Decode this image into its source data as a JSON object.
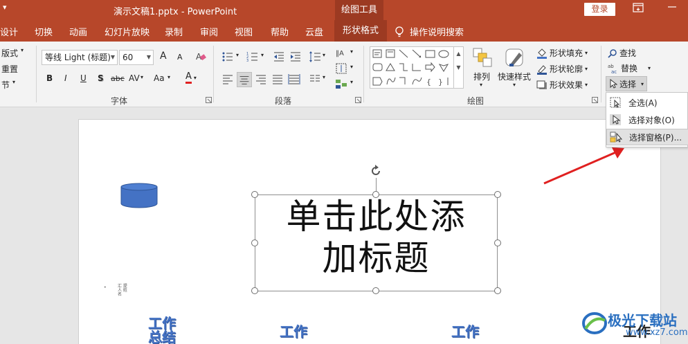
{
  "titlebar": {
    "quick_access": "▾",
    "doc_title": "演示文稿1.pptx  -  PowerPoint",
    "contextual_group": "绘图工具",
    "login": "登录"
  },
  "tabs": [
    {
      "label": "设计"
    },
    {
      "label": "切换"
    },
    {
      "label": "动画"
    },
    {
      "label": "幻灯片放映"
    },
    {
      "label": "录制"
    },
    {
      "label": "审阅"
    },
    {
      "label": "视图"
    },
    {
      "label": "帮助"
    },
    {
      "label": "云盘"
    },
    {
      "label": "形状格式"
    }
  ],
  "tell_me": "操作说明搜索",
  "ribbon": {
    "slides_group": {
      "layout": "版式",
      "reset": "重置",
      "section": "节"
    },
    "font_group": {
      "label": "字体",
      "font_name": "等线 Light (标题)",
      "font_size": "60",
      "bold": "B",
      "italic": "I",
      "underline": "U",
      "shadow": "S",
      "strike": "abc",
      "spacing": "AV",
      "case": "Aa",
      "color": "A",
      "grow": "A",
      "shrink": "A"
    },
    "paragraph_group": {
      "label": "段落"
    },
    "drawing_group": {
      "label": "绘图",
      "arrange": "排列",
      "quick_styles": "快速样式",
      "shape_fill": "形状填充",
      "shape_outline": "形状轮廓",
      "shape_effects": "形状效果"
    },
    "editing_group": {
      "find": "查找",
      "replace": "替换",
      "select": "选择"
    }
  },
  "select_menu": {
    "items": [
      {
        "label": "全选(A)"
      },
      {
        "label": "选择对象(O)"
      },
      {
        "label": "选择窗格(P)..."
      }
    ]
  },
  "slide": {
    "title_placeholder_line1": "单击此处添",
    "title_placeholder_line2": "加标题",
    "wordart_1": "工作\n总结",
    "wordart_2": "工作",
    "wordart_3": "工作",
    "wordart_4": "工作",
    "tiny_text": "汇 提\n人 姓\n名"
  },
  "watermark": {
    "brand": "极光下载站",
    "url": "www.xz7.com"
  },
  "colors": {
    "accent": "#b7472a",
    "accent_dark": "#9c3a22",
    "shape_fill": "#4472c4",
    "arrow": "#e02020"
  }
}
